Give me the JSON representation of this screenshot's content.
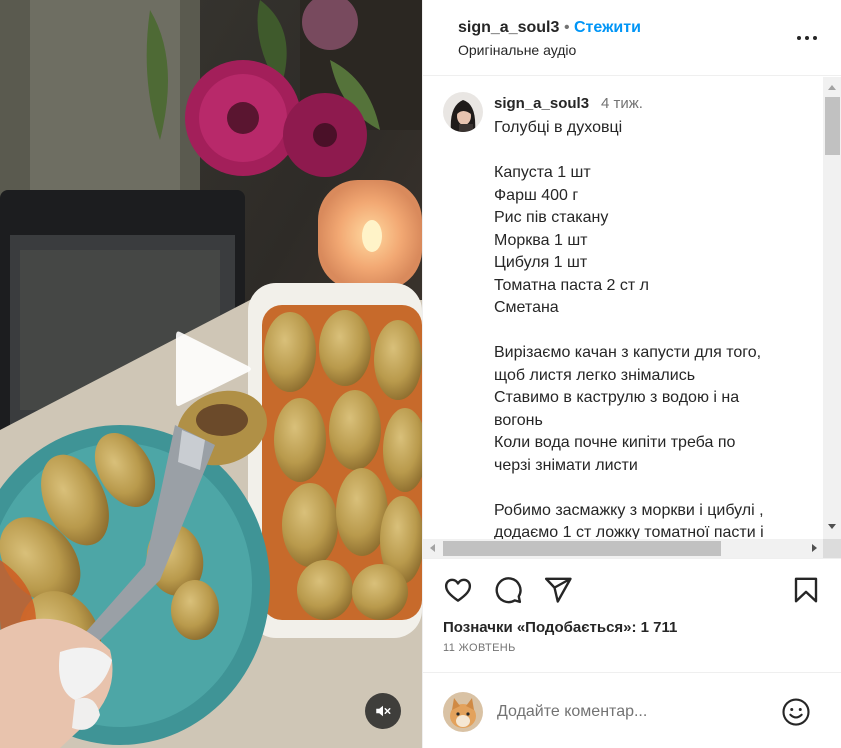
{
  "header": {
    "username": "sign_a_soul3",
    "separator": "•",
    "follow_label": "Стежити",
    "audio_label": "Оригінальне аудіо"
  },
  "caption": {
    "username": "sign_a_soul3",
    "time": "4 тиж.",
    "lines": [
      "Голубці в духовці",
      "",
      "Капуста 1 шт",
      "Фарш 400 г",
      "Рис пів стакану",
      "Морква 1 шт",
      "Цибуля 1 шт",
      "Томатна паста 2 ст л",
      "Сметана",
      "",
      "Вирізаємо качан з капусти для того,",
      "щоб листя легко знімались",
      "Ставимо в каструлю з водою і на",
      "вогонь",
      "Коли вода почне кипіти треба по",
      "черзі знімати листи",
      "",
      "Робимо засмажку з моркви і цибулі ,",
      "додаємо 1 ст ложку томатної пасти і"
    ]
  },
  "actions": {
    "like_icon": "heart-icon",
    "comment_icon": "comment-icon",
    "share_icon": "paper-plane-icon",
    "save_icon": "bookmark-icon"
  },
  "likes_text": "Позначки «Подобається»: 1 711",
  "date_text": "11 жовтень",
  "comment_box": {
    "placeholder": "Додайте коментар...",
    "emoji_icon": "smiley-icon"
  },
  "media": {
    "play_icon": "play-icon",
    "mute_icon": "speaker-muted-icon"
  },
  "colors": {
    "follow_blue": "#0095f6",
    "text_primary": "#262626",
    "text_secondary": "#737373",
    "divider": "#efefef"
  }
}
